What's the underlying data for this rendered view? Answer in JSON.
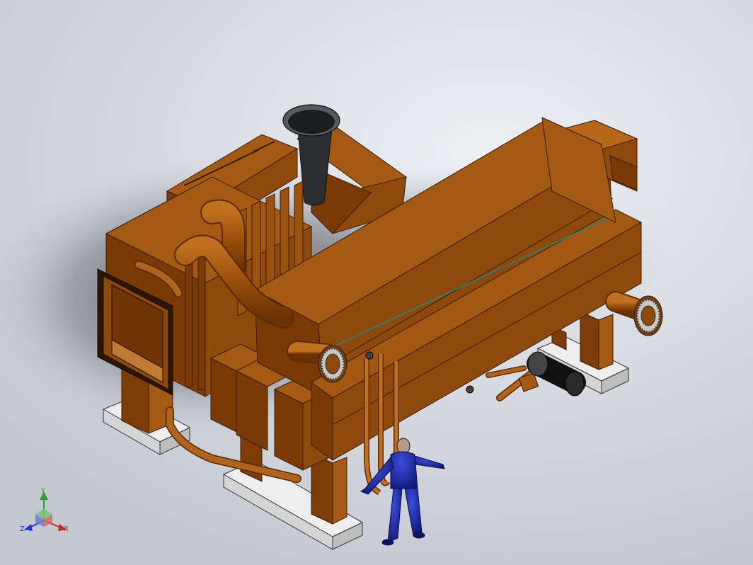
{
  "viewport": {
    "background": "#d6d9e0",
    "model_color": "#8a4207",
    "model_dark": "#5a2a04",
    "figure_color": "#1c28a8"
  },
  "triad": {
    "y_label": "Y",
    "x_label": "X",
    "z_label": "Z",
    "y_color": "#2e9e2e",
    "x_color": "#cc2222",
    "z_color": "#2233cc"
  }
}
